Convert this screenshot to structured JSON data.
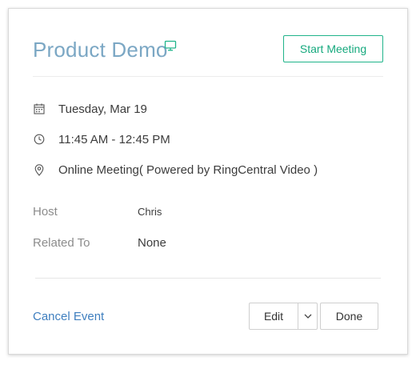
{
  "event": {
    "title": "Product Demo",
    "title_icon": "monitor-icon",
    "start_meeting_label": "Start Meeting"
  },
  "details": {
    "date": "Tuesday, Mar 19",
    "date_icon": "calendar-icon",
    "time": "11:45 AM - 12:45 PM",
    "time_icon": "clock-icon",
    "location": "Online Meeting( Powered by RingCentral Video )",
    "location_icon": "map-pin-icon"
  },
  "fields": {
    "host_label": "Host",
    "host_value": "Chris",
    "related_label": "Related To",
    "related_value": "None"
  },
  "footer": {
    "cancel_label": "Cancel Event",
    "edit_label": "Edit",
    "edit_dropdown_icon": "chevron-down-icon",
    "done_label": "Done"
  },
  "colors": {
    "title": "#7ba7c4",
    "accent_green": "#16a97e",
    "link_blue": "#3f7fbf",
    "muted_label": "#8c8c8c"
  }
}
